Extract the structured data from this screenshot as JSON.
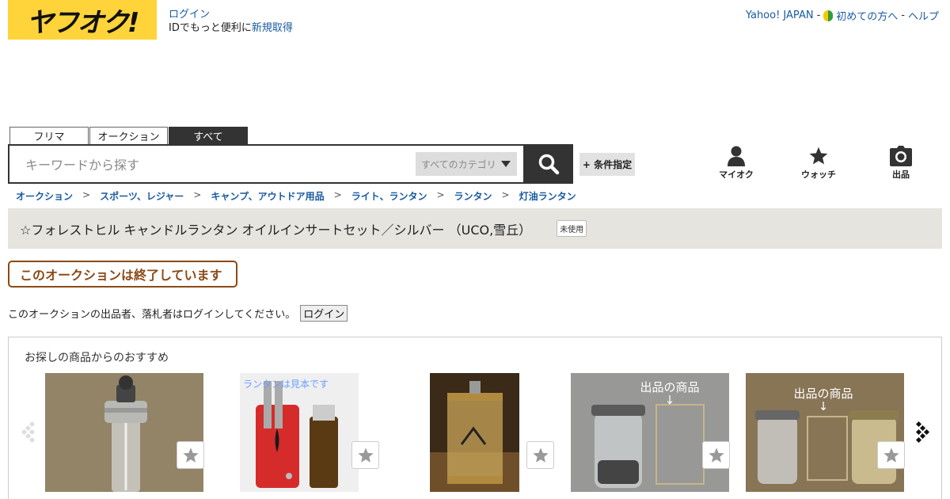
{
  "header": {
    "logo_text": "ヤフオク!",
    "login_link": "ログイン",
    "login_desc": "IDでもっと便利に",
    "signup_link": "新規取得",
    "links": [
      "Yahoo! JAPAN",
      "初めての方へ",
      "ヘルプ"
    ],
    "link_sep": "-"
  },
  "search": {
    "tabs": [
      "フリマ",
      "オークション",
      "すべて"
    ],
    "active_tab": "すべて",
    "placeholder": "キーワードから探す",
    "category": "すべてのカテゴリ",
    "condition_button": "+ 条件指定"
  },
  "utilities": [
    {
      "label": "マイオク",
      "icon": "person-icon"
    },
    {
      "label": "ウォッチ",
      "icon": "star-icon"
    },
    {
      "label": "出品",
      "icon": "camera-icon"
    }
  ],
  "breadcrumb": [
    "オークション",
    "スポーツ、レジャー",
    "キャンプ、アウトドア用品",
    "ライト、ランタン",
    "ランタン",
    "灯油ランタン"
  ],
  "breadcrumb_sep": ">",
  "item": {
    "title": "☆フォレストヒル キャンドルランタン オイルインサートセット／シルバー （UCO,雪丘）",
    "condition_badge": "未使用",
    "ended_message": "このオークションは終了しています",
    "login_notice": "このオークションの出品者、落札者はログインしてください。",
    "login_button": "ログイン"
  },
  "recommend": {
    "title": "お探しの商品からのおすすめ",
    "captions": [
      "ランタンは見本です",
      "出品の商品",
      "↓",
      "出品の商品",
      "↓"
    ]
  },
  "colors": {
    "brand_yellow": "#ffd43a",
    "link_blue": "#1a5aa0",
    "ended_brown": "#8b4a16",
    "title_bg": "#e5e4df"
  }
}
